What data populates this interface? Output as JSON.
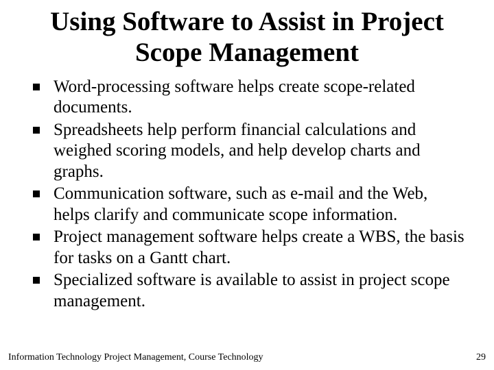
{
  "slide": {
    "title": "Using Software to Assist in Project Scope Management",
    "bullets": [
      "Word-processing software helps create scope-related documents.",
      "Spreadsheets help perform financial calculations and weighed scoring models, and help develop charts and graphs.",
      "Communication software, such as e-mail and the Web, helps clarify and communicate scope information.",
      "Project management software helps create a WBS, the basis for tasks on a Gantt chart.",
      "Specialized software is available to assist in project scope management."
    ]
  },
  "footer": {
    "source": "Information Technology Project Management, Course Technology",
    "page_number": "29"
  }
}
